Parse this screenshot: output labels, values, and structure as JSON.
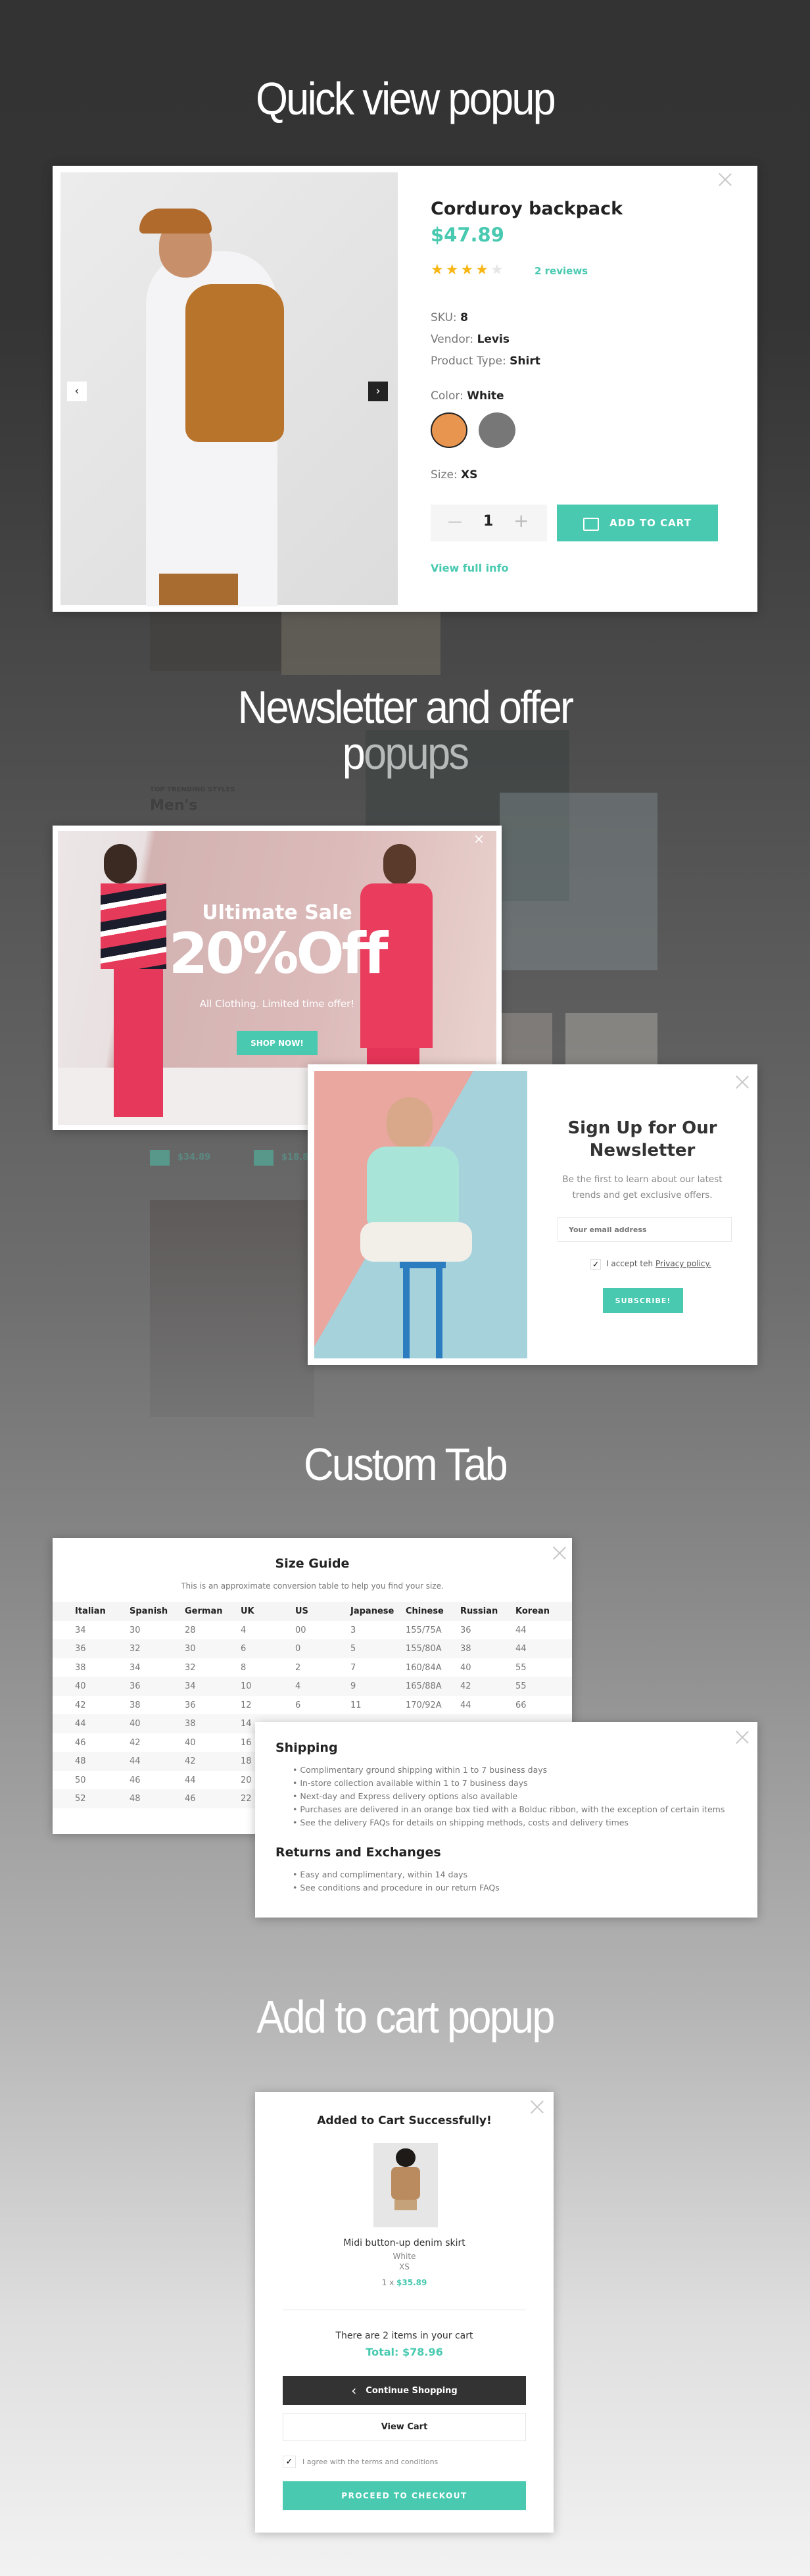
{
  "sections": {
    "quick_view": "Quick view popup",
    "newsletter": "Newsletter and offer popups",
    "custom_tab": "Custom Tab",
    "add_to_cart": "Add to cart popup"
  },
  "background_page": {
    "eyebrow": "TOP TRENDING STYLES",
    "heading": "Men's",
    "prices": [
      "$34.89",
      "$18.89"
    ]
  },
  "quick_view": {
    "title": "Corduroy backpack",
    "price": "$47.89",
    "rating": 4,
    "rating_max": 5,
    "reviews": "2 reviews",
    "sku_label": "SKU:",
    "sku": "8",
    "vendor_label": "Vendor:",
    "vendor": "Levis",
    "type_label": "Product Type:",
    "type": "Shirt",
    "color_label": "Color:",
    "color": "White",
    "swatches": [
      "#e8954f",
      "#777777"
    ],
    "size_label": "Size:",
    "size": "XS",
    "quantity": "1",
    "add_to_cart": "ADD TO CART",
    "view_full_info": "View full info"
  },
  "offer": {
    "title": "Ultimate Sale",
    "discount": "20%Off",
    "subtitle": "All Clothing. Limited time offer!",
    "cta": "SHOP NOW!"
  },
  "newsletter": {
    "title_line1": "Sign Up for Our",
    "title_line2": "Newsletter",
    "description_line1": "Be the first to learn about our latest",
    "description_line2": "trends and get exclusive offers.",
    "email_placeholder": "Your email address",
    "accept_text": "I accept teh",
    "privacy_link": "Privacy policy.",
    "accepted": true,
    "subscribe": "SUBSCRIBE!"
  },
  "size_guide": {
    "title": "Size Guide",
    "subtitle": "This is an approximate conversion table to help you find your size.",
    "columns": [
      "Italian",
      "Spanish",
      "German",
      "UK",
      "US",
      "Japanese",
      "Chinese",
      "Russian",
      "Korean"
    ],
    "rows": [
      [
        "34",
        "30",
        "28",
        "4",
        "00",
        "3",
        "155/75A",
        "36",
        "44"
      ],
      [
        "36",
        "32",
        "30",
        "6",
        "0",
        "5",
        "155/80A",
        "38",
        "44"
      ],
      [
        "38",
        "34",
        "32",
        "8",
        "2",
        "7",
        "160/84A",
        "40",
        "55"
      ],
      [
        "40",
        "36",
        "34",
        "10",
        "4",
        "9",
        "165/88A",
        "42",
        "55"
      ],
      [
        "42",
        "38",
        "36",
        "12",
        "6",
        "11",
        "170/92A",
        "44",
        "66"
      ],
      [
        "44",
        "40",
        "38",
        "14"
      ],
      [
        "46",
        "42",
        "40",
        "16"
      ],
      [
        "48",
        "44",
        "42",
        "18"
      ],
      [
        "50",
        "46",
        "44",
        "20"
      ],
      [
        "52",
        "48",
        "46",
        "22"
      ]
    ]
  },
  "shipping_tab": {
    "shipping_title": "Shipping",
    "shipping_items": [
      "Complimentary ground shipping within 1 to 7 business days",
      "In-store collection available within 1 to 7 business days",
      "Next-day and Express delivery options also available",
      "Purchases are delivered in an orange box tied with a Bolduc ribbon, with the exception of certain items",
      "See the delivery FAQs for details on shipping methods, costs and delivery times"
    ],
    "returns_title": "Returns and Exchanges",
    "returns_items": [
      "Easy and complimentary, within 14 days",
      "See conditions and procedure in our return FAQs"
    ]
  },
  "cart_popup": {
    "title": "Added to Cart Successfully!",
    "product_name": "Midi button-up denim skirt",
    "variant_color": "White",
    "variant_size": "XS",
    "qty_prefix": "1 x",
    "unit_price": "$35.89",
    "items_text": "There are 2 items in your cart",
    "total": "Total: $78.96",
    "continue": "Continue Shopping",
    "view_cart": "View Cart",
    "terms": "I agree with the terms and conditions",
    "terms_checked": true,
    "checkout": "PROCEED TO CHECKOUT"
  },
  "colors": {
    "accent": "#48c9b0",
    "dark": "#333333",
    "star": "#f7b614"
  }
}
